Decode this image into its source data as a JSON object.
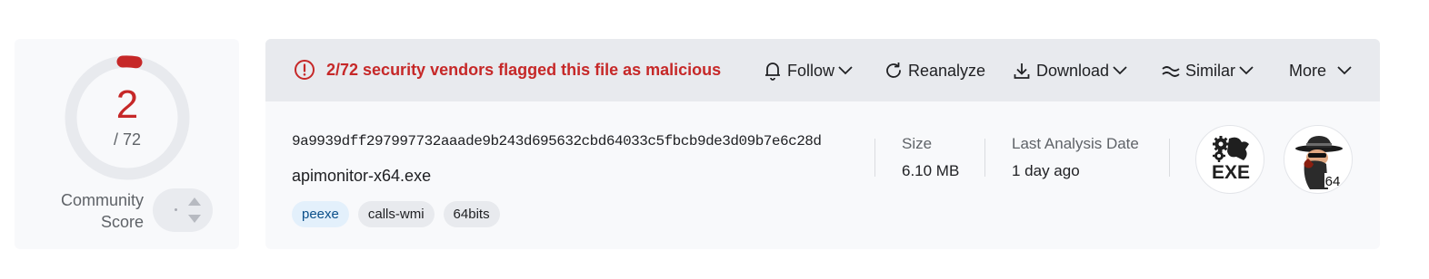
{
  "score": {
    "detections": "2",
    "total": "/ 72",
    "community_label_line1": "Community",
    "community_label_line2": "Score",
    "ring_color": "#c62828",
    "track_color": "#e8eaee"
  },
  "alert": {
    "message": "2/72 security vendors flagged this file as malicious",
    "color": "#c62828",
    "icon": "exclamation-circle-icon"
  },
  "actions": [
    {
      "label": "Follow",
      "icon": "bell-icon",
      "dropdown": true
    },
    {
      "label": "Reanalyze",
      "icon": "refresh-icon",
      "dropdown": false
    },
    {
      "label": "Download",
      "icon": "download-icon",
      "dropdown": true
    },
    {
      "label": "Similar",
      "icon": "similar-icon",
      "dropdown": true
    },
    {
      "label": "More",
      "icon": "chevron-down-icon",
      "dropdown": true
    }
  ],
  "file": {
    "hash": "9a9939dff297997732aaade9b243d695632cbd64033c5fbcb9de3d09b7e6c28d",
    "name": "apimonitor-x64.exe",
    "tags": [
      "peexe",
      "calls-wmi",
      "64bits"
    ]
  },
  "meta": {
    "size_label": "Size",
    "size_value": "6.10 MB",
    "date_label": "Last Analysis Date",
    "date_value": "1 day ago"
  },
  "badges": {
    "exe_text": "EXE",
    "exe_icon": "gears-exe-icon",
    "spy_icon": "spy-64-icon",
    "spy_text": "64"
  }
}
